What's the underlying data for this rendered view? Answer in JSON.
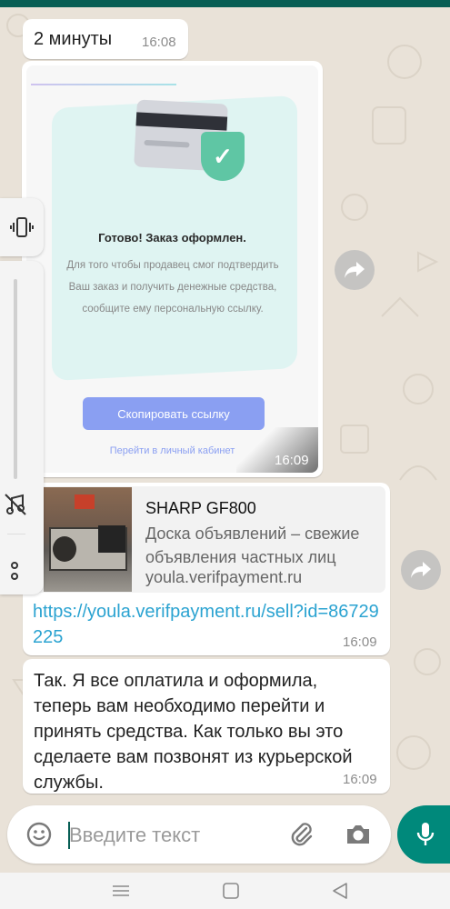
{
  "messages": {
    "m1": {
      "text": "2 минуты",
      "time": "16:08"
    },
    "m2": {
      "time": "16:09",
      "screenshot": {
        "heading": "Готово! Заказ оформлен.",
        "description": "Для того чтобы продавец смог подтвердить Ваш заказ и получить денежные средства, сообщите ему персональную ссылку.",
        "button_label": "Скопировать ссылку",
        "link_label": "Перейти в личный кабинет"
      }
    },
    "m3": {
      "preview_title": "SHARP GF800",
      "preview_description": "Доска объявлений – свежие объявления частных лиц",
      "preview_domain": "youla.verifpayment.ru",
      "link": "https://youla.verifpayment.ru/sell?id=86729225",
      "time": "16:09"
    },
    "m4": {
      "text": "Так. Я все оплатила и оформила, теперь вам необходимо перейти и принять средства. Как только вы это сделаете вам позвонят из курьерской службы.",
      "time": "16:09"
    }
  },
  "composer": {
    "placeholder": "Введите текст"
  },
  "icons": {
    "vibrate": "vibrate-icon",
    "mute": "music-off-icon",
    "more": "more-vertical-icon",
    "forward": "forward-icon",
    "emoji": "emoji-icon",
    "attach": "paperclip-icon",
    "camera": "camera-icon",
    "mic": "microphone-icon",
    "nav_menu": "recent-apps-icon",
    "nav_home": "home-icon",
    "nav_back": "back-icon"
  },
  "colors": {
    "brand": "#075e54",
    "accent": "#00897b",
    "link": "#2ba3d1",
    "chat_background": "#e9e2d8",
    "bubble": "#ffffff"
  }
}
